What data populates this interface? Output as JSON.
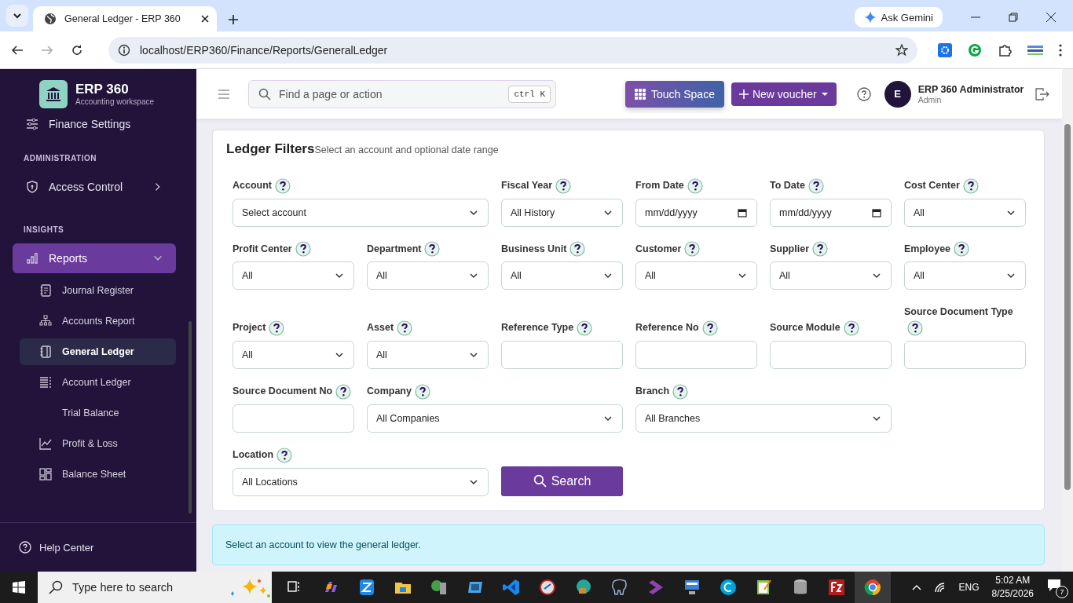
{
  "browser": {
    "tab_title": "General Ledger - ERP 360",
    "url": "localhost/ERP360/Finance/Reports/GeneralLedger",
    "gemini": "Ask Gemini"
  },
  "sidebar": {
    "brand": "ERP 360",
    "tagline": "Accounting workspace",
    "items": [
      {
        "kind": "item",
        "label": "Finance Settings",
        "selected": false
      },
      {
        "kind": "section",
        "label": "ADMINISTRATION"
      },
      {
        "kind": "item",
        "label": "Access Control",
        "selected": false,
        "expanded": false
      },
      {
        "kind": "section",
        "label": "INSIGHTS"
      },
      {
        "kind": "item",
        "label": "Reports",
        "selected": true,
        "expanded": true,
        "children": [
          {
            "label": "Journal Register",
            "selected": false
          },
          {
            "label": "Accounts Report",
            "selected": false
          },
          {
            "label": "General Ledger",
            "selected": true
          },
          {
            "label": "Account Ledger",
            "selected": false
          },
          {
            "label": "Trial Balance",
            "selected": false
          },
          {
            "label": "Profit & Loss",
            "selected": false
          },
          {
            "label": "Balance Sheet",
            "selected": false
          }
        ]
      }
    ],
    "footer": "Help Center"
  },
  "header": {
    "search_placeholder": "Find a page or action",
    "shortcut": "ctrl K",
    "touch_space": "Touch Space",
    "new_voucher": "New voucher",
    "user": {
      "initial": "E",
      "name": "ERP 360 Administrator",
      "role": "Admin"
    }
  },
  "filters": {
    "title": "Ledger Filters",
    "subtitle": "Select an account and optional date range",
    "fields": [
      {
        "label": "Account",
        "kind": "select",
        "value": "Select account"
      },
      {
        "label": "Fiscal Year",
        "kind": "select",
        "value": "All History"
      },
      {
        "label": "From Date",
        "kind": "date",
        "placeholder": "mm/dd/yyyy"
      },
      {
        "label": "To Date",
        "kind": "date",
        "placeholder": "mm/dd/yyyy"
      },
      {
        "label": "Cost Center",
        "kind": "select",
        "value": "All"
      },
      {
        "label": "Profit Center",
        "kind": "select",
        "value": "All"
      },
      {
        "label": "Department",
        "kind": "select",
        "value": "All"
      },
      {
        "label": "Business Unit",
        "kind": "select",
        "value": "All"
      },
      {
        "label": "Customer",
        "kind": "select",
        "value": "All"
      },
      {
        "label": "Supplier",
        "kind": "select",
        "value": "All"
      },
      {
        "label": "Employee",
        "kind": "select",
        "value": "All"
      },
      {
        "label": "Project",
        "kind": "select",
        "value": "All"
      },
      {
        "label": "Asset",
        "kind": "select",
        "value": "All"
      },
      {
        "label": "Reference Type",
        "kind": "text"
      },
      {
        "label": "Reference No",
        "kind": "text"
      },
      {
        "label": "Source Module",
        "kind": "text"
      },
      {
        "label": "Source Document Type",
        "kind": "text"
      },
      {
        "label": "Source Document No",
        "kind": "text"
      },
      {
        "label": "Company",
        "kind": "select",
        "value": "All Companies"
      },
      {
        "label": "Branch",
        "kind": "select",
        "value": "All Branches"
      },
      {
        "label": "Location",
        "kind": "select",
        "value": "All Locations"
      }
    ],
    "search_button": "Search"
  },
  "alert": "Select an account to view the general ledger.",
  "taskbar": {
    "search_placeholder": "Type here to search",
    "language": "ENG",
    "time": "5:02 AM",
    "date": "8/25/2026",
    "notifications": "7"
  }
}
